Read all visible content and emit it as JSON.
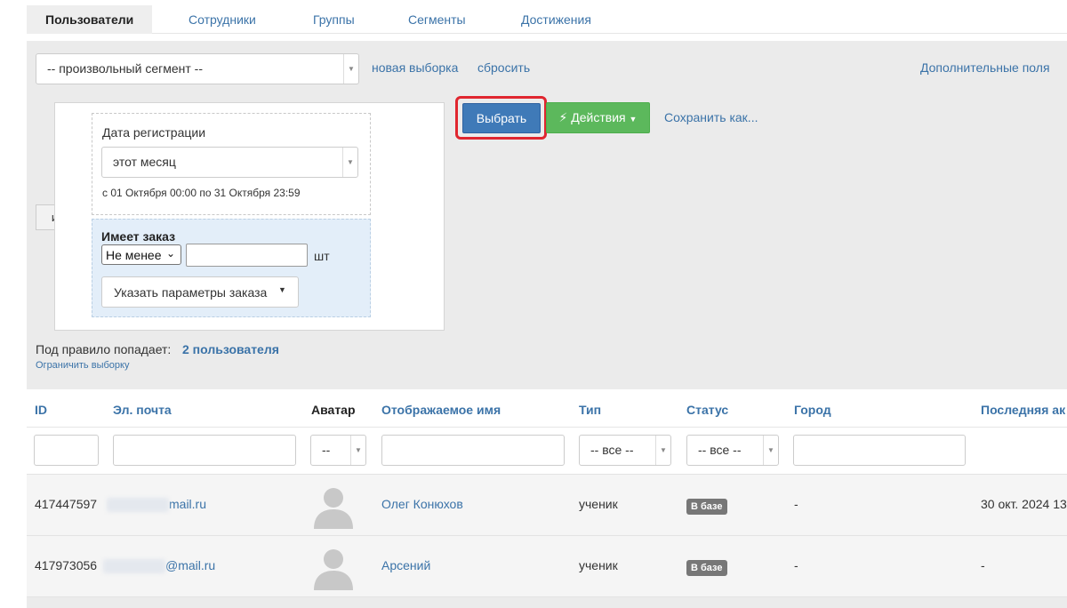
{
  "tabs": [
    {
      "label": "Пользователи",
      "active": true
    },
    {
      "label": "Сотрудники"
    },
    {
      "label": "Группы"
    },
    {
      "label": "Сегменты"
    },
    {
      "label": "Достижения"
    }
  ],
  "filters": {
    "segment_select": "-- произвольный сегмент --",
    "new_selection": "новая выборка",
    "reset": "сбросить",
    "extra_fields": "Дополнительные поля",
    "and_label": "и",
    "reg_date": {
      "title": "Дата регистрации",
      "value": "этот месяц",
      "range": "с 01 Октября 00:00 по 31 Октября 23:59"
    },
    "has_order": {
      "title": "Имеет заказ",
      "operator": "Не менее",
      "quantity_value": "",
      "unit": "шт",
      "params_button": "Указать параметры заказа"
    },
    "select_button": "Выбрать",
    "actions_button": "Действия",
    "save_as": "Сохранить как...",
    "result_prefix": "Под правило попадает:",
    "result_count": "2 пользователя",
    "limit_link": "Ограничить выборку"
  },
  "table": {
    "columns": [
      "ID",
      "Эл. почта",
      "Аватар",
      "Отображаемое имя",
      "Тип",
      "Статус",
      "Город",
      "Последняя ак"
    ],
    "filter_avatar": "--",
    "filter_type": "-- все --",
    "filter_status": "-- все --",
    "rows": [
      {
        "id": "417447597",
        "email": "mail.ru",
        "name": "Олег Конюхов",
        "type": "ученик",
        "status": "В базе",
        "city": "-",
        "last": "30 окт. 2024 13"
      },
      {
        "id": "417973056",
        "email": "@mail.ru",
        "name": "Арсений",
        "type": "ученик",
        "status": "В базе",
        "city": "-",
        "last": "-"
      }
    ]
  },
  "colors": {
    "link": "#3b73a8",
    "primary": "#3f7ab8",
    "success": "#5cb85c",
    "highlight": "#e0262f",
    "badge": "#777777"
  },
  "icons": [
    "chevron-down-icon",
    "lightning-icon",
    "caret-down-icon",
    "avatar-placeholder-icon"
  ]
}
